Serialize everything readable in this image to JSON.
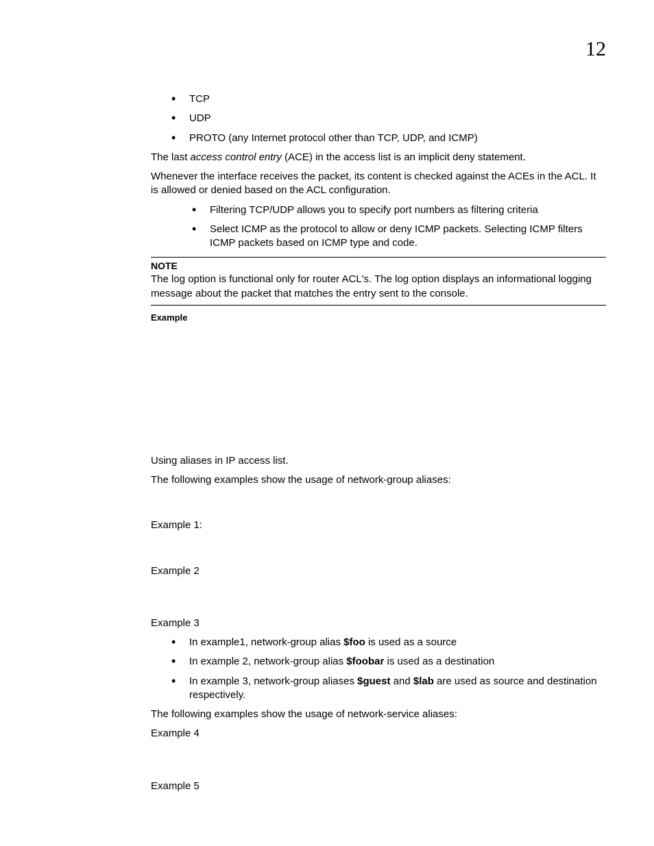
{
  "pageNumber": "12",
  "bullets1": {
    "b1": "TCP",
    "b2": "UDP",
    "b3": "PROTO (any Internet protocol other than TCP, UDP, and ICMP)"
  },
  "para1": {
    "prefix": "The last ",
    "italic": "access control entry",
    "suffix": " (ACE) in the access list is an implicit deny statement."
  },
  "para2": "Whenever the interface receives the packet, its content is checked against the ACEs in the ACL. It is allowed or denied based on the ACL configuration.",
  "bullets2": {
    "b1": "Filtering TCP/UDP allows you to specify port numbers as filtering criteria",
    "b2": "Select ICMP as the protocol to allow or deny ICMP packets. Selecting ICMP filters ICMP packets based on ICMP type and code."
  },
  "note": {
    "label": "NOTE",
    "text": "The log option is functional only for router ACL's. The log option displays an informational logging message about the packet that matches the entry sent to the console."
  },
  "exampleLabel": "Example",
  "aliasIntro": "Using aliases in IP access list.",
  "aliasDesc": "The following examples show the usage of network-group aliases:",
  "ex1": "Example 1:",
  "ex2": "Example 2",
  "ex3": "Example 3",
  "bullets3": {
    "b1_pre": "In example1, network-group alias ",
    "b1_bold": "$foo",
    "b1_post": " is used as a source",
    "b2_pre": "In example 2, network-group alias ",
    "b2_bold": "$foobar",
    "b2_post": " is used as a destination",
    "b3_pre": "In example 3, network-group aliases ",
    "b3_bold1": "$guest",
    "b3_mid": " and ",
    "b3_bold2": "$lab",
    "b3_post": " are used as source and destination respectively."
  },
  "serviceDesc": "The following examples show the usage of network-service aliases:",
  "ex4": "Example 4",
  "ex5": "Example 5"
}
